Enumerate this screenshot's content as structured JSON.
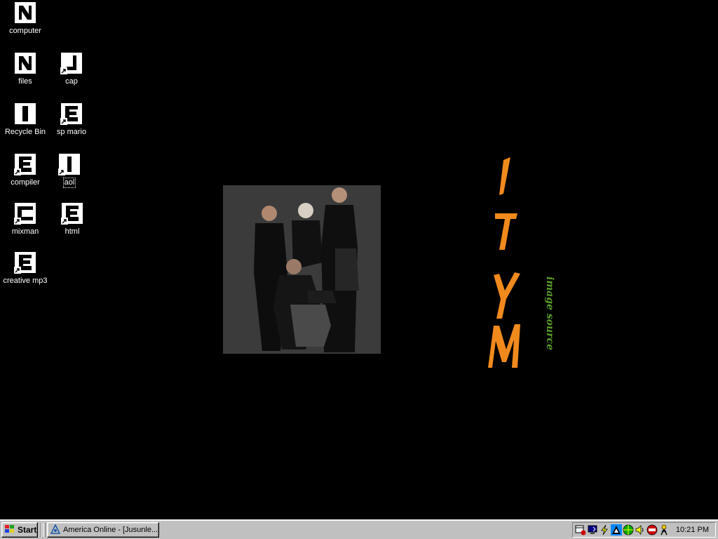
{
  "desktop": {
    "icons": [
      {
        "label": "computer",
        "kind": "computer-icon",
        "shortcut": false
      },
      {
        "label": "files",
        "kind": "folder-icon",
        "shortcut": false
      },
      {
        "label": "cap",
        "kind": "folder-shortcut-icon",
        "shortcut": true
      },
      {
        "label": "Recycle Bin",
        "kind": "recycle-bin-icon",
        "shortcut": false
      },
      {
        "label": "sp mario",
        "kind": "document-icon",
        "shortcut": true
      },
      {
        "label": "compiler",
        "kind": "document-icon",
        "shortcut": true
      },
      {
        "label": "aol",
        "kind": "program-icon",
        "shortcut": true
      },
      {
        "label": "mixman",
        "kind": "window-icon",
        "shortcut": true
      },
      {
        "label": "html",
        "kind": "document-icon",
        "shortcut": true
      },
      {
        "label": "creative mp3",
        "kind": "document-icon",
        "shortcut": true
      }
    ],
    "focused_icon": "aol",
    "wallpaper": {
      "logo_text": "1TYM",
      "tagline": "image source",
      "logo_color": "#f08a1c",
      "tagline_color": "#5aa02c"
    }
  },
  "taskbar": {
    "start_label": "Start",
    "tasks": [
      {
        "label": "America  Online - [Jusunle...",
        "icon": "aol-triangle-icon"
      }
    ],
    "tray_icons": [
      "scheduler-icon",
      "display-icon",
      "power-icon",
      "network-icon",
      "globe-icon",
      "volume-icon",
      "antivirus-icon",
      "aim-icon"
    ],
    "clock": "10:21 PM"
  },
  "colors": {
    "desktop_bg": "#000000",
    "taskbar_bg": "#c0c0c0"
  }
}
